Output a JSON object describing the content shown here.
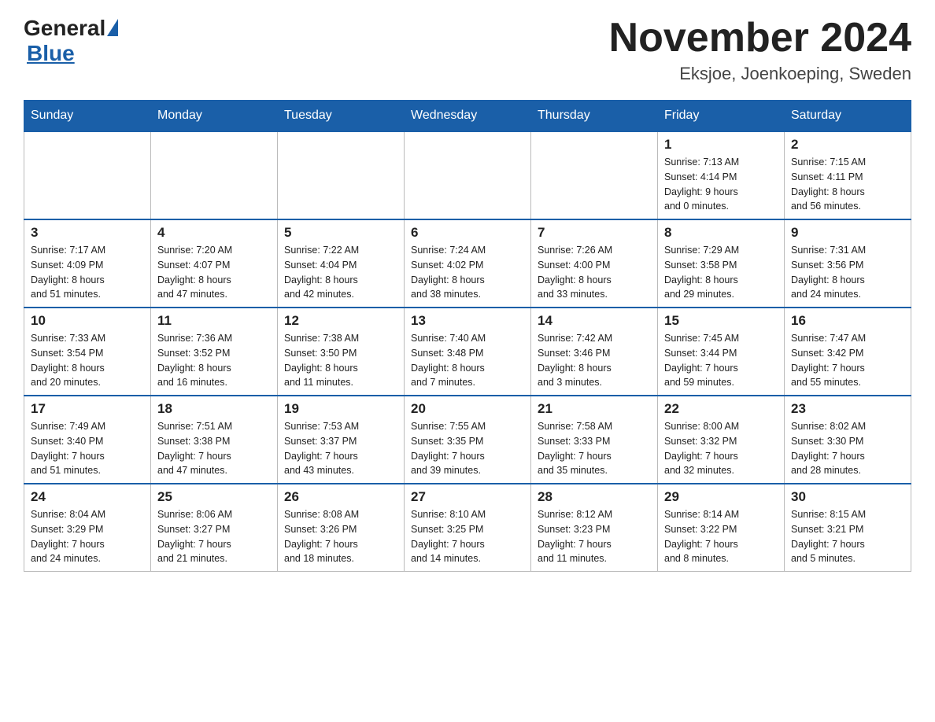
{
  "header": {
    "logo_general": "General",
    "logo_blue": "Blue",
    "month_title": "November 2024",
    "location": "Eksjoe, Joenkoeping, Sweden"
  },
  "days_of_week": [
    "Sunday",
    "Monday",
    "Tuesday",
    "Wednesday",
    "Thursday",
    "Friday",
    "Saturday"
  ],
  "weeks": [
    [
      {
        "day": "",
        "info": ""
      },
      {
        "day": "",
        "info": ""
      },
      {
        "day": "",
        "info": ""
      },
      {
        "day": "",
        "info": ""
      },
      {
        "day": "",
        "info": ""
      },
      {
        "day": "1",
        "info": "Sunrise: 7:13 AM\nSunset: 4:14 PM\nDaylight: 9 hours\nand 0 minutes."
      },
      {
        "day": "2",
        "info": "Sunrise: 7:15 AM\nSunset: 4:11 PM\nDaylight: 8 hours\nand 56 minutes."
      }
    ],
    [
      {
        "day": "3",
        "info": "Sunrise: 7:17 AM\nSunset: 4:09 PM\nDaylight: 8 hours\nand 51 minutes."
      },
      {
        "day": "4",
        "info": "Sunrise: 7:20 AM\nSunset: 4:07 PM\nDaylight: 8 hours\nand 47 minutes."
      },
      {
        "day": "5",
        "info": "Sunrise: 7:22 AM\nSunset: 4:04 PM\nDaylight: 8 hours\nand 42 minutes."
      },
      {
        "day": "6",
        "info": "Sunrise: 7:24 AM\nSunset: 4:02 PM\nDaylight: 8 hours\nand 38 minutes."
      },
      {
        "day": "7",
        "info": "Sunrise: 7:26 AM\nSunset: 4:00 PM\nDaylight: 8 hours\nand 33 minutes."
      },
      {
        "day": "8",
        "info": "Sunrise: 7:29 AM\nSunset: 3:58 PM\nDaylight: 8 hours\nand 29 minutes."
      },
      {
        "day": "9",
        "info": "Sunrise: 7:31 AM\nSunset: 3:56 PM\nDaylight: 8 hours\nand 24 minutes."
      }
    ],
    [
      {
        "day": "10",
        "info": "Sunrise: 7:33 AM\nSunset: 3:54 PM\nDaylight: 8 hours\nand 20 minutes."
      },
      {
        "day": "11",
        "info": "Sunrise: 7:36 AM\nSunset: 3:52 PM\nDaylight: 8 hours\nand 16 minutes."
      },
      {
        "day": "12",
        "info": "Sunrise: 7:38 AM\nSunset: 3:50 PM\nDaylight: 8 hours\nand 11 minutes."
      },
      {
        "day": "13",
        "info": "Sunrise: 7:40 AM\nSunset: 3:48 PM\nDaylight: 8 hours\nand 7 minutes."
      },
      {
        "day": "14",
        "info": "Sunrise: 7:42 AM\nSunset: 3:46 PM\nDaylight: 8 hours\nand 3 minutes."
      },
      {
        "day": "15",
        "info": "Sunrise: 7:45 AM\nSunset: 3:44 PM\nDaylight: 7 hours\nand 59 minutes."
      },
      {
        "day": "16",
        "info": "Sunrise: 7:47 AM\nSunset: 3:42 PM\nDaylight: 7 hours\nand 55 minutes."
      }
    ],
    [
      {
        "day": "17",
        "info": "Sunrise: 7:49 AM\nSunset: 3:40 PM\nDaylight: 7 hours\nand 51 minutes."
      },
      {
        "day": "18",
        "info": "Sunrise: 7:51 AM\nSunset: 3:38 PM\nDaylight: 7 hours\nand 47 minutes."
      },
      {
        "day": "19",
        "info": "Sunrise: 7:53 AM\nSunset: 3:37 PM\nDaylight: 7 hours\nand 43 minutes."
      },
      {
        "day": "20",
        "info": "Sunrise: 7:55 AM\nSunset: 3:35 PM\nDaylight: 7 hours\nand 39 minutes."
      },
      {
        "day": "21",
        "info": "Sunrise: 7:58 AM\nSunset: 3:33 PM\nDaylight: 7 hours\nand 35 minutes."
      },
      {
        "day": "22",
        "info": "Sunrise: 8:00 AM\nSunset: 3:32 PM\nDaylight: 7 hours\nand 32 minutes."
      },
      {
        "day": "23",
        "info": "Sunrise: 8:02 AM\nSunset: 3:30 PM\nDaylight: 7 hours\nand 28 minutes."
      }
    ],
    [
      {
        "day": "24",
        "info": "Sunrise: 8:04 AM\nSunset: 3:29 PM\nDaylight: 7 hours\nand 24 minutes."
      },
      {
        "day": "25",
        "info": "Sunrise: 8:06 AM\nSunset: 3:27 PM\nDaylight: 7 hours\nand 21 minutes."
      },
      {
        "day": "26",
        "info": "Sunrise: 8:08 AM\nSunset: 3:26 PM\nDaylight: 7 hours\nand 18 minutes."
      },
      {
        "day": "27",
        "info": "Sunrise: 8:10 AM\nSunset: 3:25 PM\nDaylight: 7 hours\nand 14 minutes."
      },
      {
        "day": "28",
        "info": "Sunrise: 8:12 AM\nSunset: 3:23 PM\nDaylight: 7 hours\nand 11 minutes."
      },
      {
        "day": "29",
        "info": "Sunrise: 8:14 AM\nSunset: 3:22 PM\nDaylight: 7 hours\nand 8 minutes."
      },
      {
        "day": "30",
        "info": "Sunrise: 8:15 AM\nSunset: 3:21 PM\nDaylight: 7 hours\nand 5 minutes."
      }
    ]
  ]
}
